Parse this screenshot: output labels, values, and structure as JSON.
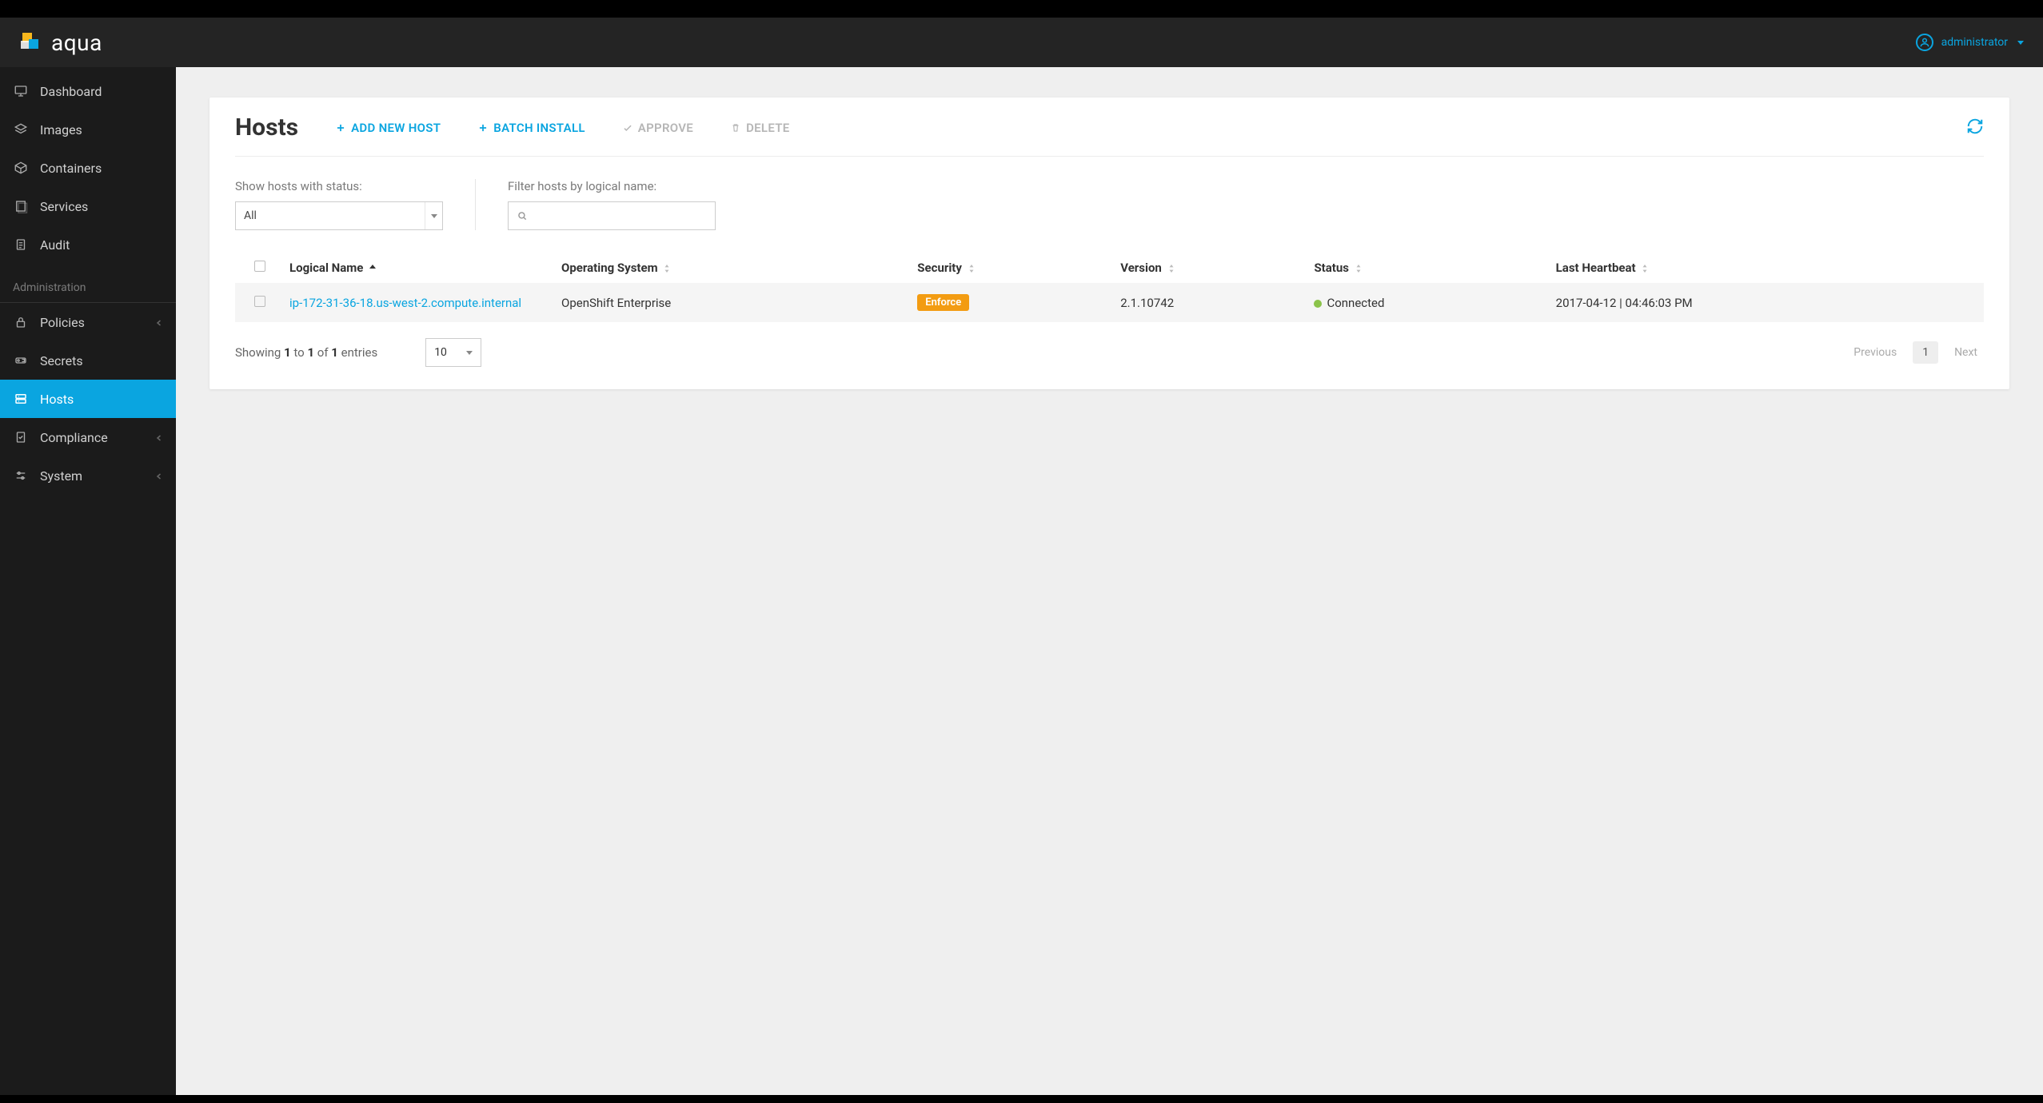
{
  "brand": "aqua",
  "user": "administrator",
  "sidebar": {
    "items": [
      {
        "label": "Dashboard"
      },
      {
        "label": "Images"
      },
      {
        "label": "Containers"
      },
      {
        "label": "Services"
      },
      {
        "label": "Audit"
      }
    ],
    "section_label": "Administration",
    "admin_items": [
      {
        "label": "Policies",
        "expandable": true
      },
      {
        "label": "Secrets"
      },
      {
        "label": "Hosts",
        "active": true
      },
      {
        "label": "Compliance",
        "expandable": true
      },
      {
        "label": "System",
        "expandable": true
      }
    ]
  },
  "page": {
    "title": "Hosts",
    "actions": {
      "add": "ADD NEW HOST",
      "batch": "BATCH INSTALL",
      "approve": "APPROVE",
      "delete": "DELETE"
    }
  },
  "filters": {
    "status_label": "Show hosts with status:",
    "status_value": "All",
    "name_label": "Filter hosts by logical name:",
    "name_value": ""
  },
  "table": {
    "headers": {
      "logical_name": "Logical Name",
      "os": "Operating System",
      "security": "Security",
      "version": "Version",
      "status": "Status",
      "heartbeat": "Last Heartbeat"
    },
    "rows": [
      {
        "logical_name": "ip-172-31-36-18.us-west-2.compute.internal",
        "os": "OpenShift Enterprise",
        "security": "Enforce",
        "version": "2.1.10742",
        "status": "Connected",
        "heartbeat": "2017-04-12 | 04:46:03 PM"
      }
    ]
  },
  "footer": {
    "showing_prefix": "Showing ",
    "from": "1",
    "to_word": " to ",
    "to": "1",
    "of_word": " of ",
    "total": "1",
    "entries_word": " entries",
    "page_size": "10",
    "previous": "Previous",
    "current_page": "1",
    "next": "Next"
  }
}
